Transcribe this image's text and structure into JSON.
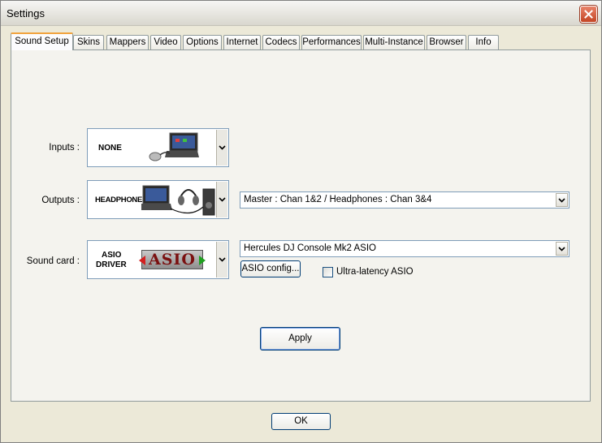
{
  "window": {
    "title": "Settings"
  },
  "tabs": [
    {
      "label": "Sound Setup",
      "active": true
    },
    {
      "label": "Skins"
    },
    {
      "label": "Mappers"
    },
    {
      "label": "Video"
    },
    {
      "label": "Options"
    },
    {
      "label": "Internet"
    },
    {
      "label": "Codecs"
    },
    {
      "label": "Performances"
    },
    {
      "label": "Multi-Instance"
    },
    {
      "label": "Browser"
    },
    {
      "label": "Info"
    }
  ],
  "sound_setup": {
    "inputs": {
      "label": "Inputs :",
      "value": "NONE",
      "icon": "laptop-mouse-icon"
    },
    "outputs": {
      "label": "Outputs :",
      "value": "HEADPHONES",
      "icon": "laptop-headphones-speaker-icon",
      "routing": "Master : Chan 1&2 / Headphones : Chan 3&4"
    },
    "sound_card": {
      "label": "Sound card :",
      "value_line1": "ASIO",
      "value_line2": "DRIVER",
      "logo_text": "ASIO",
      "device": "Hercules DJ Console Mk2 ASIO",
      "config_button": "ASIO config...",
      "ultra_latency_label": "Ultra-latency ASIO",
      "ultra_latency_checked": false
    },
    "apply_button": "Apply"
  },
  "footer": {
    "ok_button": "OK"
  },
  "colors": {
    "close_red": "#c44524",
    "active_tab_accent": "#f1a33c",
    "border_blue": "#7f9db9"
  }
}
